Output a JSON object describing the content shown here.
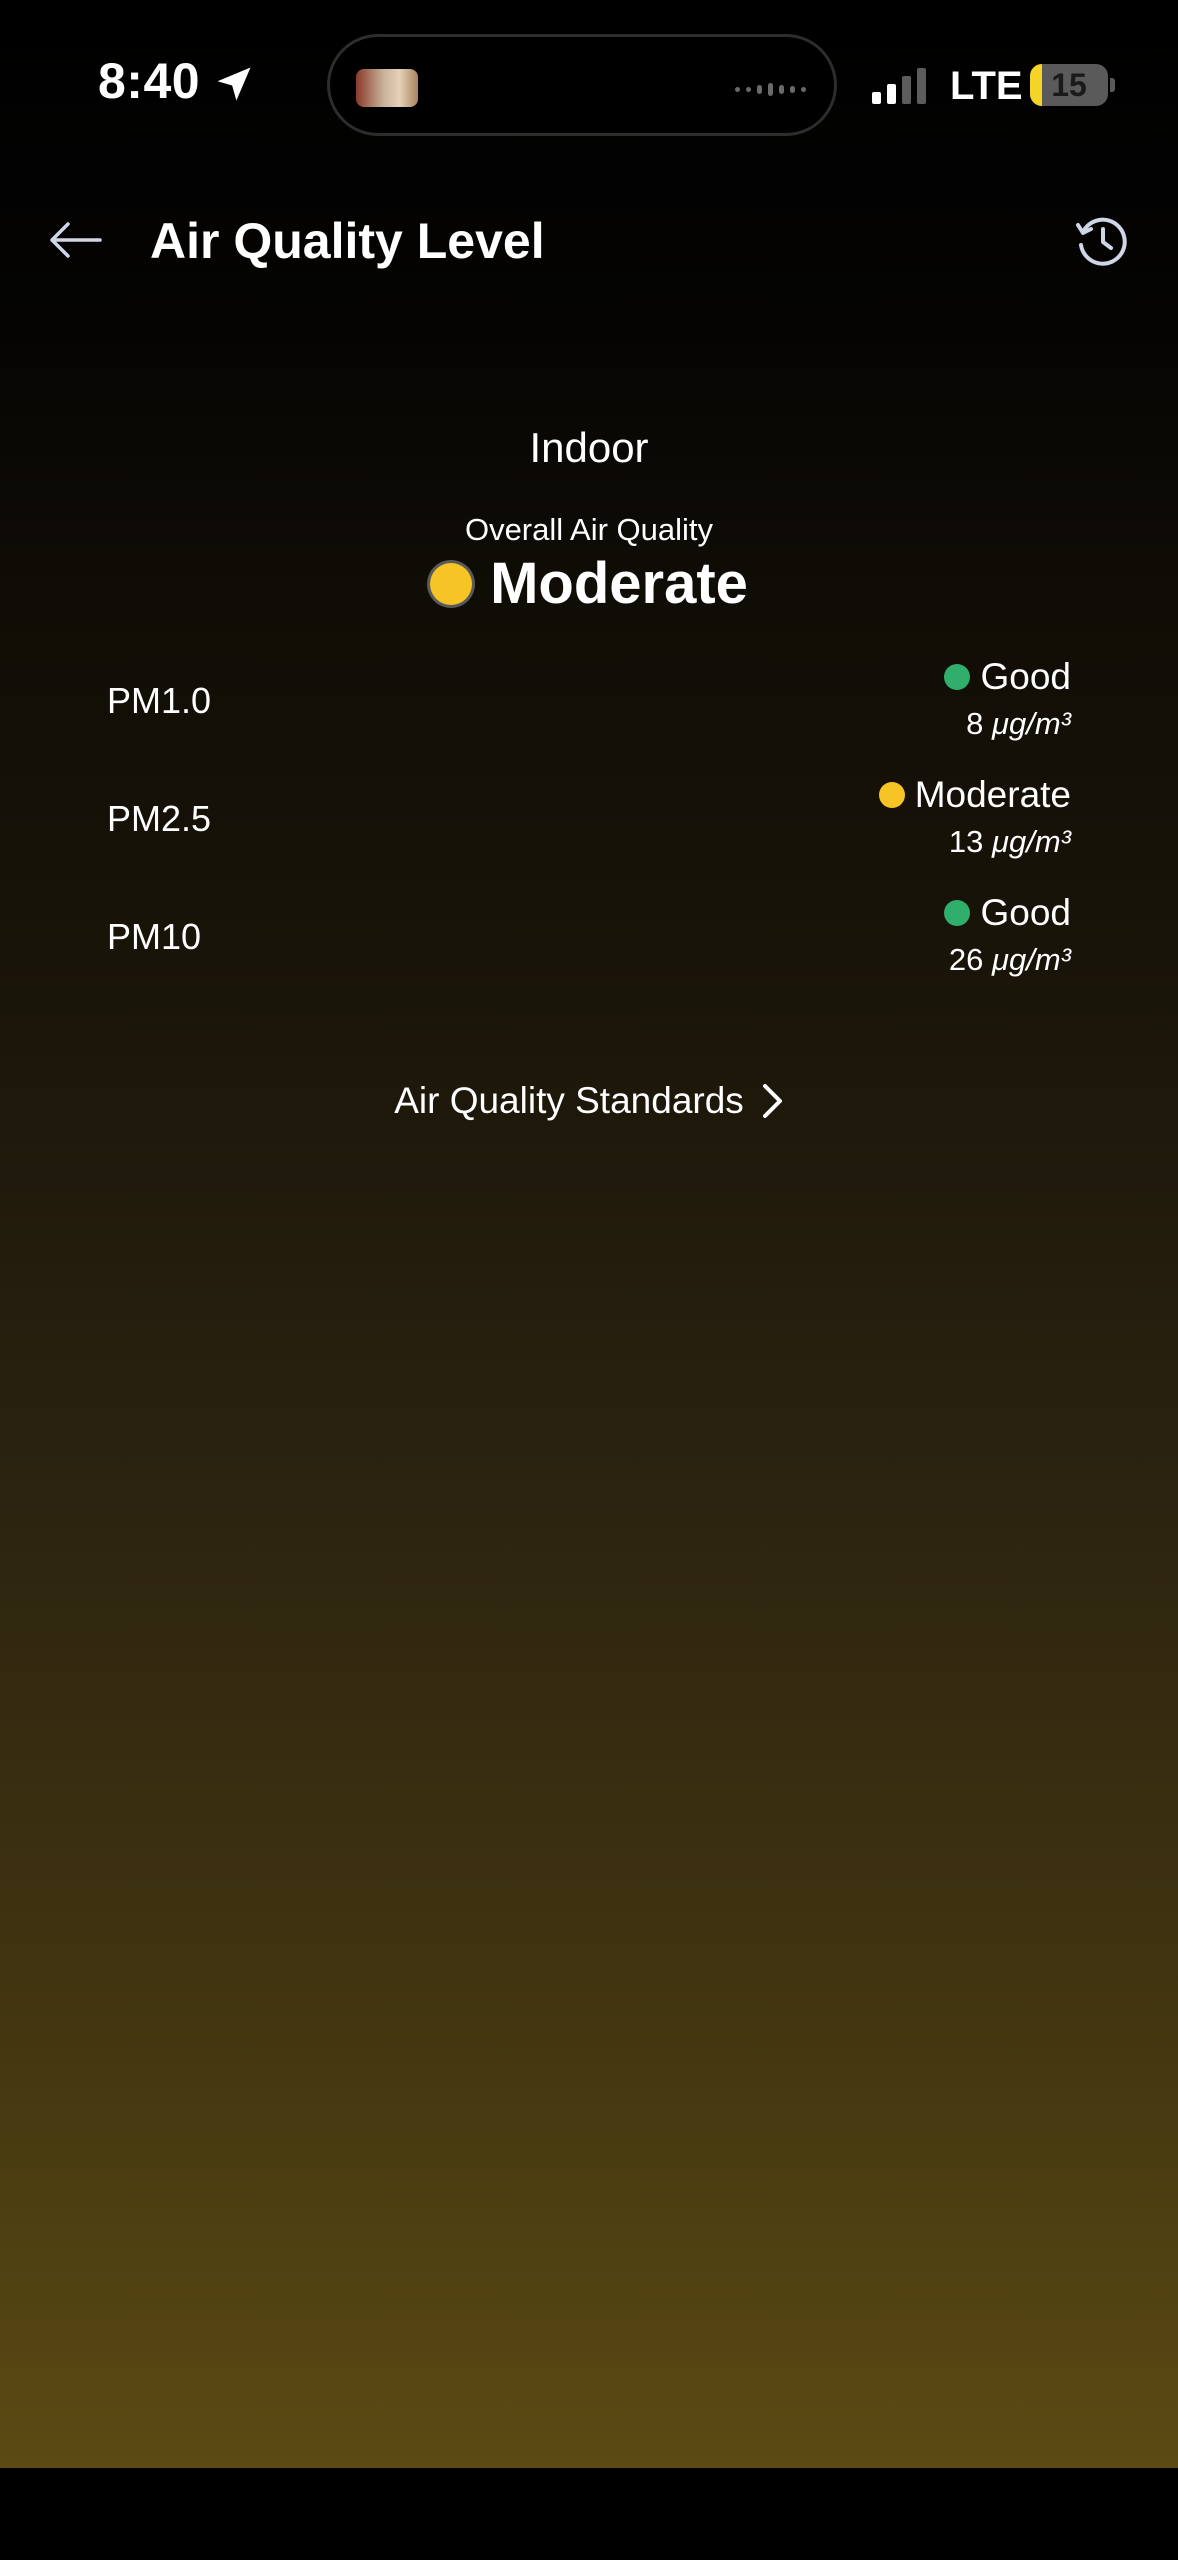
{
  "status_bar": {
    "time": "8:40",
    "carrier": "LTE",
    "battery_level": "15",
    "battery_percent": 15,
    "battery_color": "#f5d428"
  },
  "header": {
    "title": "Air Quality Level",
    "back_icon": "arrow-left-icon",
    "history_icon": "history-clock-icon"
  },
  "overall": {
    "section": "Indoor",
    "label": "Overall Air Quality",
    "value": "Moderate",
    "color": "#f7c425"
  },
  "pollutants": [
    {
      "name": "PM1.0",
      "status": "Good",
      "value": "8",
      "unit": "μg/m³",
      "color": "#2fae6c"
    },
    {
      "name": "PM2.5",
      "status": "Moderate",
      "value": "13",
      "unit": "μg/m³",
      "color": "#f7c425"
    },
    {
      "name": "PM10",
      "status": "Good",
      "value": "26",
      "unit": "μg/m³",
      "color": "#2fae6c"
    }
  ],
  "standards": {
    "label": "Air Quality Standards",
    "icon": "chevron-right-icon"
  }
}
